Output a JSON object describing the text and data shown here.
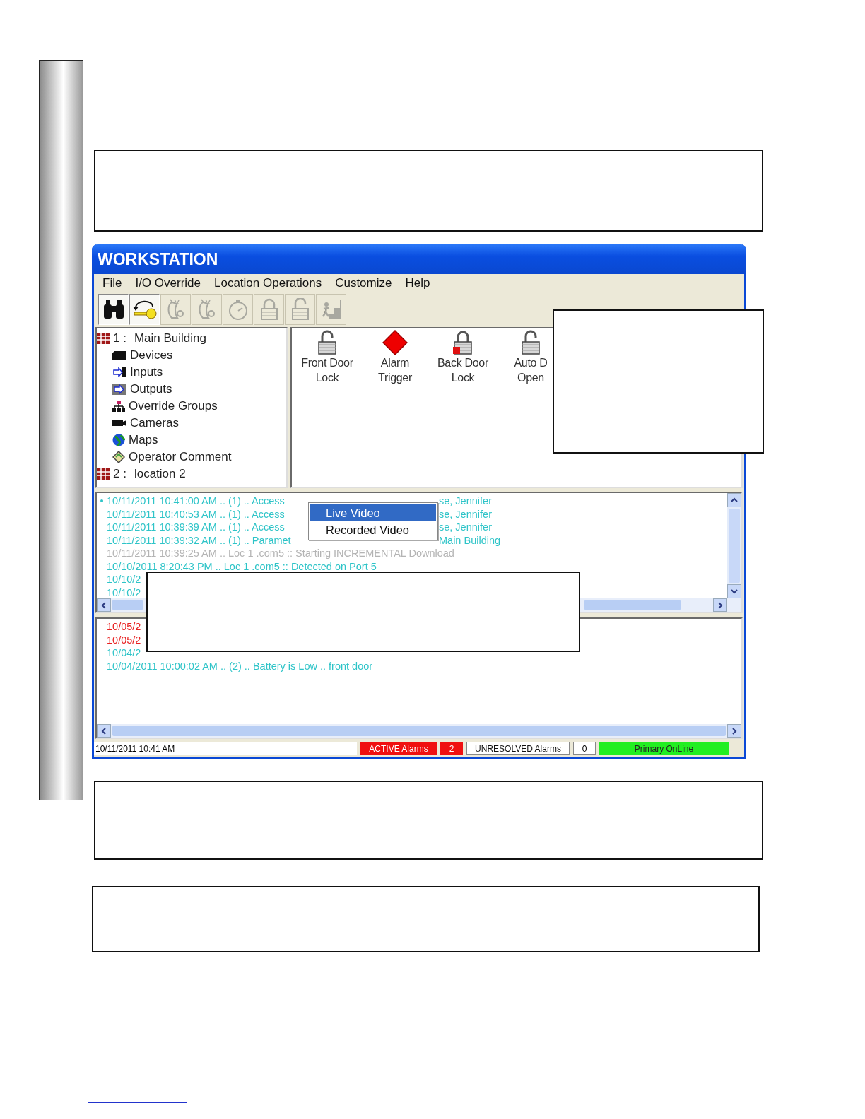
{
  "window": {
    "title": "WORKSTATION"
  },
  "menu_bar": [
    "File",
    "I/O Override",
    "Location Operations",
    "Customize",
    "Help"
  ],
  "toolbar": [
    {
      "kind": "binoculars",
      "disabled": false
    },
    {
      "kind": "key",
      "disabled": false
    },
    {
      "kind": "hand",
      "disabled": true
    },
    {
      "kind": "hand",
      "disabled": true
    },
    {
      "kind": "timer",
      "disabled": true
    },
    {
      "kind": "lock",
      "disabled": true
    },
    {
      "kind": "unlock",
      "disabled": true
    },
    {
      "kind": "exit",
      "disabled": true
    }
  ],
  "tree": [
    {
      "number": "1 :",
      "label": "Main Building",
      "children": [
        {
          "kind": "devices",
          "label": "Devices"
        },
        {
          "kind": "inputs",
          "label": "Inputs"
        },
        {
          "kind": "outputs",
          "label": "Outputs"
        },
        {
          "kind": "groups",
          "label": "Override Groups"
        },
        {
          "kind": "cameras",
          "label": "Cameras"
        },
        {
          "kind": "maps",
          "label": "Maps"
        },
        {
          "kind": "comment",
          "label": "Operator Comment"
        }
      ]
    },
    {
      "number": "2 :",
      "label": "location 2"
    }
  ],
  "devices": [
    {
      "kind": "lock_open",
      "label": [
        "Front Door",
        "Lock"
      ]
    },
    {
      "kind": "alarm",
      "label": [
        "Alarm",
        "Trigger"
      ]
    },
    {
      "kind": "lock_alarm",
      "label": [
        "Back Door",
        "Lock"
      ]
    },
    {
      "kind": "lock_open",
      "label": [
        "Auto D",
        "Open"
      ]
    }
  ],
  "event_log": [
    {
      "bullet": "•",
      "text": "10/11/2011 10:41:00 AM .. (1) .. Access",
      "tail": "se, Jennifer",
      "color": "#2ec4c8"
    },
    {
      "text": "10/11/2011 10:40:53 AM .. (1) .. Access",
      "tail": "se, Jennifer",
      "color": "#2ec4c8"
    },
    {
      "text": "10/11/2011 10:39:39 AM .. (1) .. Access",
      "tail": "se, Jennifer",
      "color": "#2ec4c8"
    },
    {
      "text": "10/11/2011 10:39:32 AM .. (1) .. Paramet",
      "tail": "Main Building",
      "color": "#2ec4c8"
    },
    {
      "text": "10/11/2011 10:39:25 AM .. Loc 1 .com5 :: Starting INCREMENTAL Download",
      "color": "#b4b4b4"
    },
    {
      "text": "10/10/2011 8:20:43 PM .. Loc 1 .com5 :: Detected on Port 5",
      "color": "#2ec4c8"
    },
    {
      "text": "10/10/2",
      "color": "#2ec4c8"
    },
    {
      "text": "10/10/2",
      "color": "#2ec4c8"
    }
  ],
  "alarm_log": [
    {
      "text": "10/05/2",
      "color": "#e82020"
    },
    {
      "text": "10/05/2",
      "color": "#e82020"
    },
    {
      "text": "10/04/2",
      "color": "#2ec4c8"
    },
    {
      "text": "10/04/2011 10:00:02 AM .. (2) .. Battery is Low .. front door",
      "color": "#2ec4c8"
    }
  ],
  "context_menu": [
    {
      "label": "Live Video",
      "selected": true
    },
    {
      "label": "Recorded Video",
      "selected": false
    }
  ],
  "status_bar": {
    "datetime": "10/11/2011 10:41 AM",
    "active_label": "ACTIVE Alarms",
    "active_count": "2",
    "unresolved_label": "UNRESOLVED Alarms",
    "unresolved_count": "0",
    "connection": "Primary OnLine"
  }
}
